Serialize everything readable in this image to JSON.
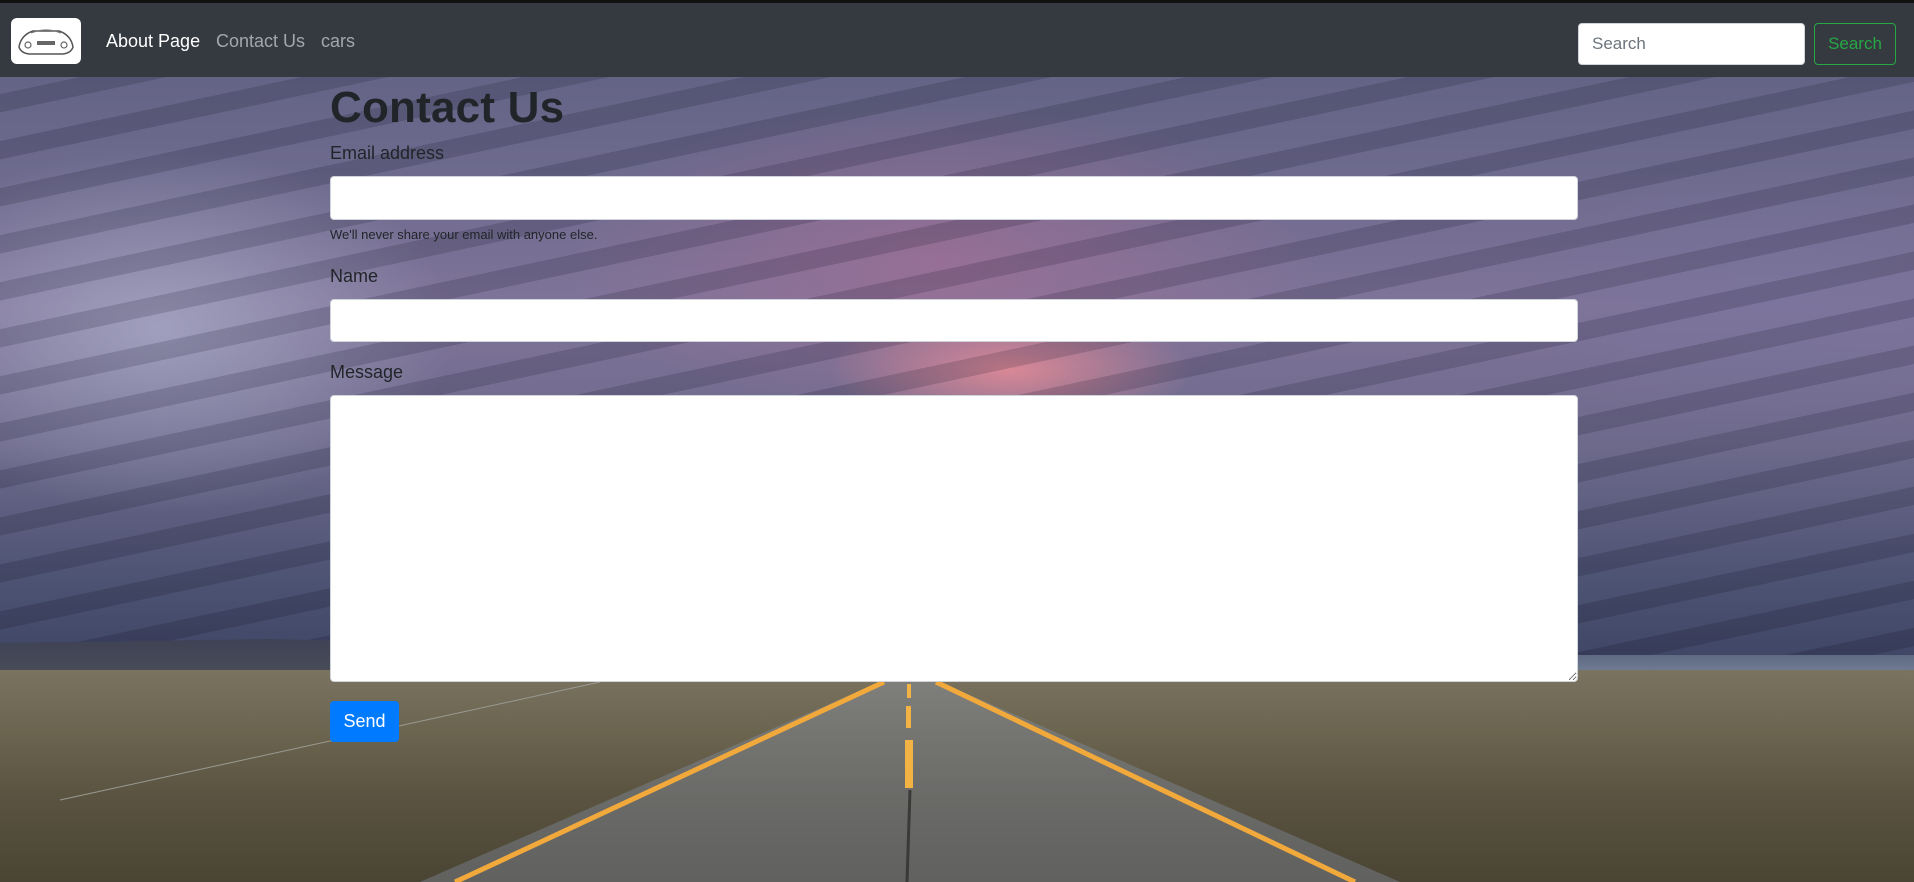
{
  "navbar": {
    "brand_icon": "car-logo-icon",
    "links": [
      {
        "label": "About Page",
        "active": true
      },
      {
        "label": "Contact Us",
        "active": false
      },
      {
        "label": "cars",
        "active": false
      }
    ],
    "search": {
      "placeholder": "Search",
      "value": "",
      "button_label": "Search"
    }
  },
  "form": {
    "title": "Contact Us",
    "email": {
      "label": "Email address",
      "value": "",
      "help": "We'll never share your email with anyone else."
    },
    "name": {
      "label": "Name",
      "value": ""
    },
    "message": {
      "label": "Message",
      "value": ""
    },
    "submit_label": "Send"
  },
  "colors": {
    "navbar_bg": "#343a40",
    "primary": "#007bff",
    "success": "#28a745",
    "road_line": "#f2a93b"
  }
}
